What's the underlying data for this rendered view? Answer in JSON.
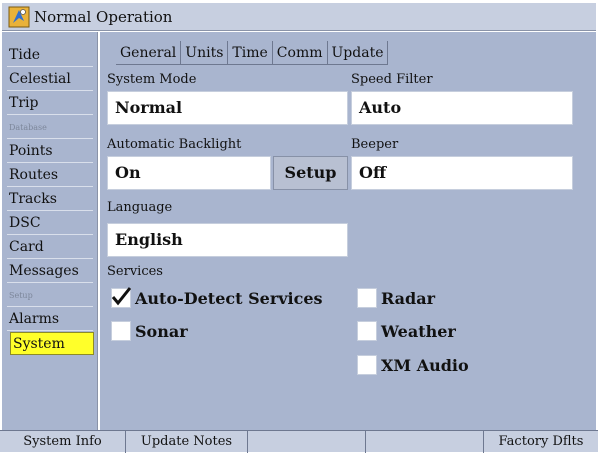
{
  "title": "Normal Operation",
  "sidebar": {
    "items": [
      {
        "label": "Tide",
        "type": "item"
      },
      {
        "label": "Celestial",
        "type": "item"
      },
      {
        "label": "Trip",
        "type": "item"
      },
      {
        "label": "Database",
        "type": "header"
      },
      {
        "label": "Points",
        "type": "item"
      },
      {
        "label": "Routes",
        "type": "item"
      },
      {
        "label": "Tracks",
        "type": "item"
      },
      {
        "label": "DSC",
        "type": "item"
      },
      {
        "label": "Card",
        "type": "item"
      },
      {
        "label": "Messages",
        "type": "item"
      },
      {
        "label": "Setup",
        "type": "header"
      },
      {
        "label": "Alarms",
        "type": "item"
      },
      {
        "label": "System",
        "type": "item",
        "selected": true
      }
    ]
  },
  "tabs": [
    "General",
    "Units",
    "Time",
    "Comm",
    "Update"
  ],
  "form": {
    "system_mode_label": "System Mode",
    "system_mode_value": "Normal",
    "speed_filter_label": "Speed Filter",
    "speed_filter_value": "Auto",
    "backlight_label": "Automatic Backlight",
    "backlight_value": "On",
    "setup_button": "Setup",
    "beeper_label": "Beeper",
    "beeper_value": "Off",
    "language_label": "Language",
    "language_value": "English",
    "services_label": "Services",
    "services": [
      {
        "label": "Auto-Detect Services",
        "checked": true
      },
      {
        "label": "Sonar",
        "checked": false
      },
      {
        "label": "Radar",
        "checked": false
      },
      {
        "label": "Weather",
        "checked": false
      },
      {
        "label": "XM Audio",
        "checked": false
      }
    ]
  },
  "softkeys": [
    "System Info",
    "Update Notes",
    "",
    "",
    "Factory Dflts"
  ],
  "colors": {
    "panel": "#a9b5cf",
    "titlebar": "#c7cfe0",
    "selected": "#ffff2a"
  }
}
